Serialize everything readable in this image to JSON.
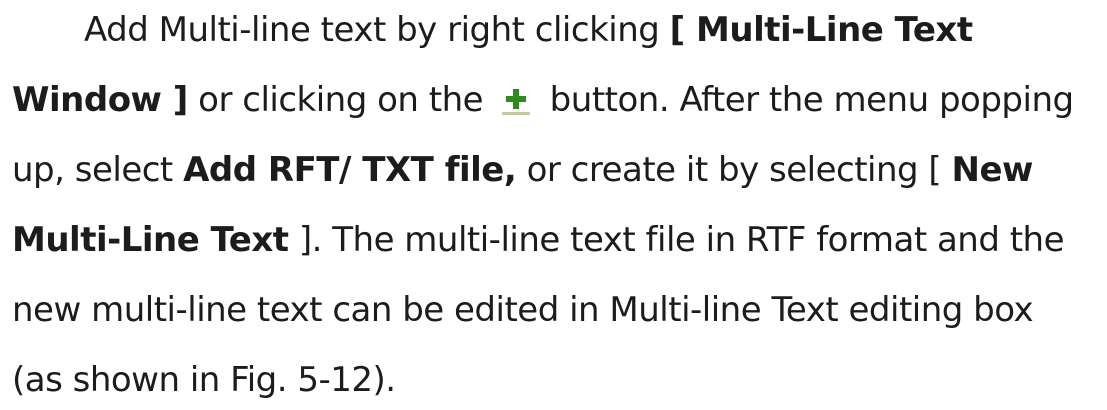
{
  "paragraph": {
    "line1": {
      "t1": "Add Multi-line text by right clicking ",
      "b1": "[ Multi-Line Text"
    },
    "line2": {
      "b1": "Window ]",
      "t1": " or clicking on the ",
      "icon": "add-plus-icon",
      "t2": " button. After the menu popping"
    },
    "line3": {
      "t1": "up, select ",
      "b1": "Add RFT/ TXT file,",
      "t2": " or create it by selecting [ ",
      "b2": "New"
    },
    "line4": {
      "b1": "Multi-Line Text",
      "t1": " ]. The multi-line text file in RTF format and the"
    },
    "line5": {
      "t1": "new multi-line text can be edited in Multi-line Text editing box"
    },
    "line6": {
      "t1": "(as shown in Fig. 5-12)."
    }
  },
  "colors": {
    "text": "#1c1c1c",
    "icon_plus": "#2e8b1e",
    "icon_underline": "#c8c8a0"
  }
}
